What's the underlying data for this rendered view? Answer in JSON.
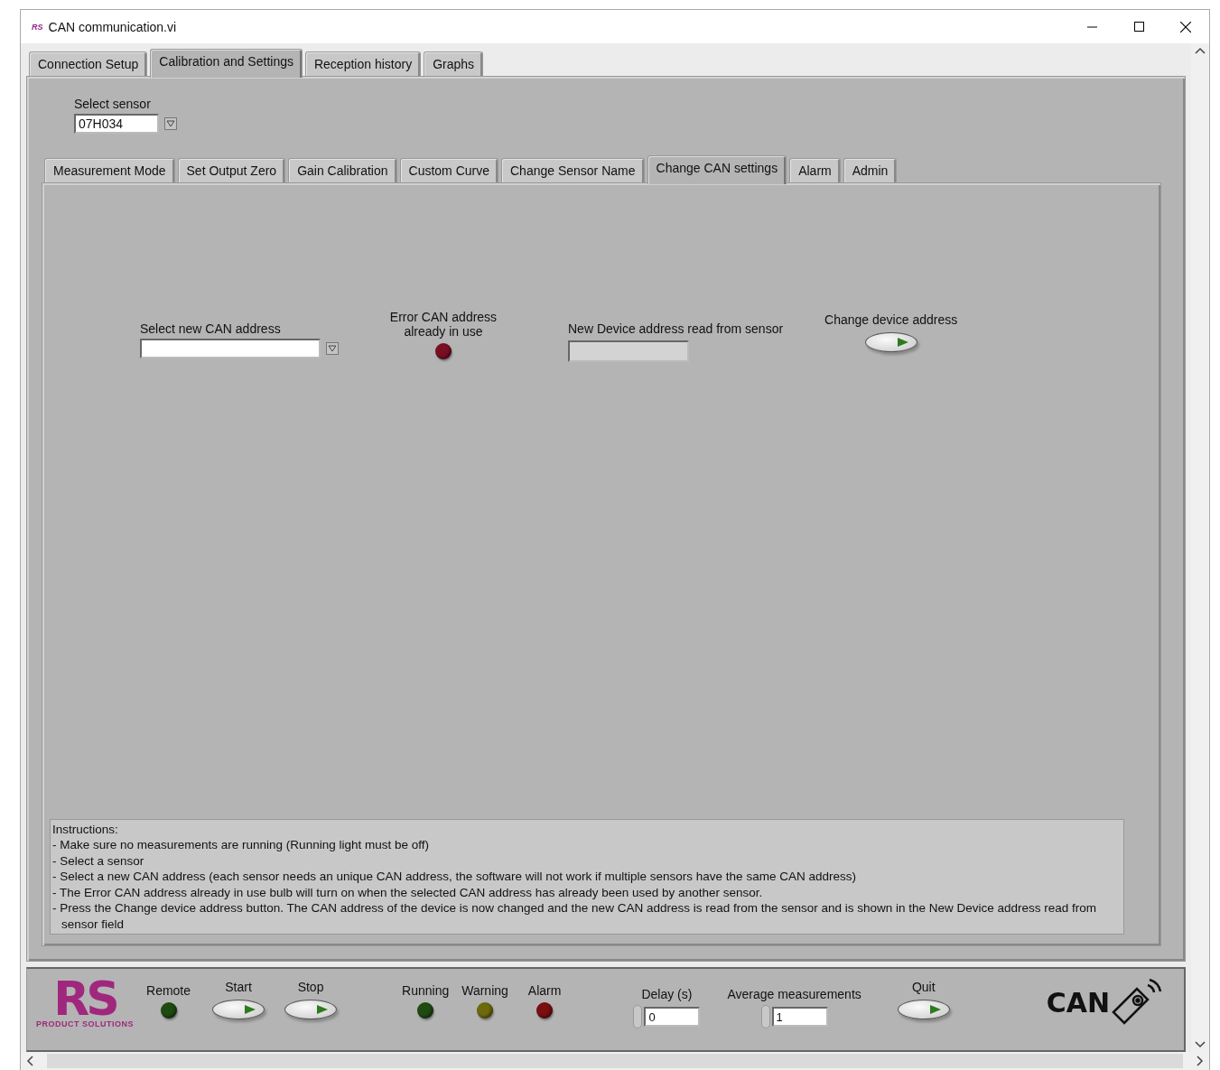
{
  "window": {
    "icon_text": "RS",
    "title": "CAN communication.vi"
  },
  "tabs": [
    {
      "label": "Connection Setup",
      "selected": false
    },
    {
      "label": "Calibration and Settings",
      "selected": true
    },
    {
      "label": "Reception history",
      "selected": false
    },
    {
      "label": "Graphs",
      "selected": false
    }
  ],
  "select_sensor": {
    "label": "Select sensor",
    "value": "07H034"
  },
  "sub_tabs": [
    {
      "label": "Measurement Mode",
      "selected": false
    },
    {
      "label": "Set Output Zero",
      "selected": false
    },
    {
      "label": "Gain Calibration",
      "selected": false
    },
    {
      "label": "Custom Curve",
      "selected": false
    },
    {
      "label": "Change Sensor Name",
      "selected": false
    },
    {
      "label": "Change CAN settings",
      "selected": true
    },
    {
      "label": "Alarm",
      "selected": false
    },
    {
      "label": "Admin",
      "selected": false
    }
  ],
  "can_settings": {
    "new_address": {
      "label": "Select new CAN address"
    },
    "error_indicator": {
      "label": "Error CAN address already in use",
      "color": "#7a0f24",
      "on": false
    },
    "read_address": {
      "label": "New Device address read from sensor"
    },
    "change_button": {
      "label": "Change device address"
    }
  },
  "instructions": {
    "title": "Instructions:",
    "lines": [
      "- Make sure no measurements are running (Running light must be off)",
      "- Select a sensor",
      "- Select a new CAN address (each sensor needs an unique CAN address, the software will not work if multiple sensors have the same CAN address)",
      "- The Error CAN address already in use bulb will turn on when the selected CAN address has already been used by another sensor.",
      "- Press the Change device address button. The CAN address of the device is now changed and the new CAN address is read from the sensor and is shown in the New Device address read from sensor field"
    ]
  },
  "footer": {
    "logo": {
      "letters": "RS",
      "tagline": "PRODUCT SOLUTIONS"
    },
    "controls": [
      {
        "kind": "led",
        "label": "Remote",
        "color": "#1f4a12",
        "on": false
      },
      {
        "kind": "button",
        "label": "Start"
      },
      {
        "kind": "button",
        "label": "Stop"
      },
      {
        "kind": "led",
        "label": "Running",
        "color": "#1f4a12",
        "on": false
      },
      {
        "kind": "led",
        "label": "Warning",
        "color": "#6e6a0c",
        "on": false
      },
      {
        "kind": "led",
        "label": "Alarm",
        "color": "#7a0f10",
        "on": false
      },
      {
        "kind": "numeric",
        "label": "Delay (s)",
        "value": "0"
      },
      {
        "kind": "numeric",
        "label": "Average measurements",
        "value": "1"
      },
      {
        "kind": "button",
        "label": "Quit"
      }
    ],
    "can_logo": "CAN"
  }
}
